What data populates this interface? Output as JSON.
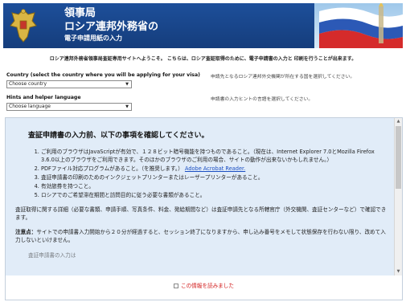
{
  "header": {
    "line1": "領事局",
    "line2": "ロシア連邦外務省の",
    "line3": "電子申請用紙の入力",
    "emblem_icon": "double-headed-eagle-icon",
    "flag_icon": "russian-flag-icon",
    "colors": {
      "banner": "#1d4f9a"
    }
  },
  "welcome": "ロシア連邦外務省領事局査証専用サイトへようこそ。 こちらは、ロシア査証取得のために、電子申請書の入力と 印刷を行うことが出来ます。",
  "country": {
    "label": "Country (select the country where you will be applying for your visa)",
    "value": "Choose country",
    "hint": "申請先となるロシア連邦外交機関が所在する国を選択してください。"
  },
  "language": {
    "label": "Hints and helper language",
    "value": "Choose language",
    "hint": "申請書の入力ヒントの言語を選択してください。"
  },
  "panel": {
    "title": "査証申請書の入力前、以下の事項を確認してください。",
    "items": [
      "ご利用のブラウザはJavaScriptが有効で、１２８ビット暗号機能を持つものであること。（現在は、Internet Explorer 7.0とMozilla Firefox 3.6.0以上のブラウザをご利用できます。そのほかのブラウザのご利用の場合、サイトの動作が出来ないかもしれません。）",
      "PDFファイル対応プログラムがあること。（を推奨します。）",
      "査証申請書の印刷のためのインクジェットプリンターまたはレーザープリンターがあること。",
      "有効旅券を持つこと。",
      "ロシアでのご希望滞在期間と訪問目的に従う必要な書類があること。"
    ],
    "link_text": "Adobe Acrobat Reader.",
    "para1": "査証取得に関する詳細（必要な書類、申請手順、写真条件、料金、発給期間など）は査証申請先となる所轄官庁（外交機関、査証センターなど）で確認できます。",
    "note_label": "注意点：",
    "note_text": "サイトでの申請書入力開始から２０分が経過すると、セッション終了になりますから、申し込み番号をメモして状態保存を行わない限り、改めて入力しないといけません。",
    "cut_text": "査証申請書の入力は",
    "confirm": "この情報を読みました",
    "colors": {
      "panel_bg": "#e1ecf8",
      "confirm": "#d11a1a",
      "link": "#1a4ec2"
    }
  }
}
